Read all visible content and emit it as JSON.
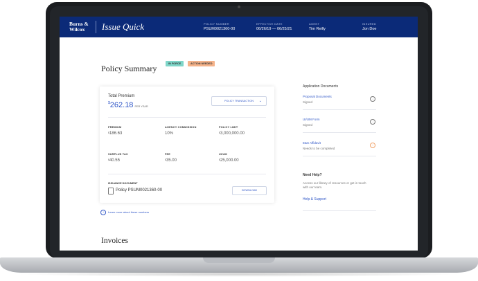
{
  "header": {
    "brand": "Burns & Wilcox",
    "product": "Issue Quick",
    "meta": [
      {
        "label": "POLICY NUMBER",
        "value": "PSUM0021360-00"
      },
      {
        "label": "EFFECTIVE DATE",
        "value": "06/26/19 — 06/25/21"
      },
      {
        "label": "AGENT",
        "value": "Tim Reilly"
      },
      {
        "label": "INSURED",
        "value": "Jon Doe"
      }
    ]
  },
  "page": {
    "title": "Policy Summary",
    "badges": {
      "in_force": "IN FORCE",
      "action_needed": "ACTION NEEDED"
    }
  },
  "summary": {
    "total_premium_label": "Total Premium",
    "currency": "$",
    "total_premium_value": "262.18",
    "per_year": "PER YEAR",
    "transaction_label": "POLICY TRANSACTION",
    "fields": [
      {
        "label": "PREMIUM",
        "value": "186.63"
      },
      {
        "label": "AGENCY COMMISSION",
        "value": "10%"
      },
      {
        "label": "POLICY LIMIT",
        "value": "3,000,000.00"
      },
      {
        "label": "SURPLUS TAX",
        "value": "40.55"
      },
      {
        "label": "FEE",
        "value": "35.00"
      },
      {
        "label": "UI/UM",
        "value": "25,000.00"
      }
    ],
    "issuance_label": "ISSUANCE DOCUMENT",
    "issuance_doc": "Policy PSUM0021360-00",
    "download_label": "DOWNLOAD",
    "learn_more": "Learn more about these numbers"
  },
  "invoices": {
    "title": "Invoices"
  },
  "sidebar": {
    "documents_title": "Application Documents",
    "documents": [
      {
        "title": "Proposal Documents",
        "status": "Signed"
      },
      {
        "title": "UI/UM Form",
        "status": "Signed"
      },
      {
        "title": "E&S Affidavit",
        "status": "Needs to be completed"
      }
    ],
    "help_title": "Need Help?",
    "help_text": "Access our library of resources or get in touch with our team.",
    "help_link": "Help & Support"
  },
  "colors": {
    "navy": "#0b2a78",
    "accent": "#2f56c7",
    "in_force": "#7fd6c9",
    "action_needed": "#f5b38a"
  }
}
